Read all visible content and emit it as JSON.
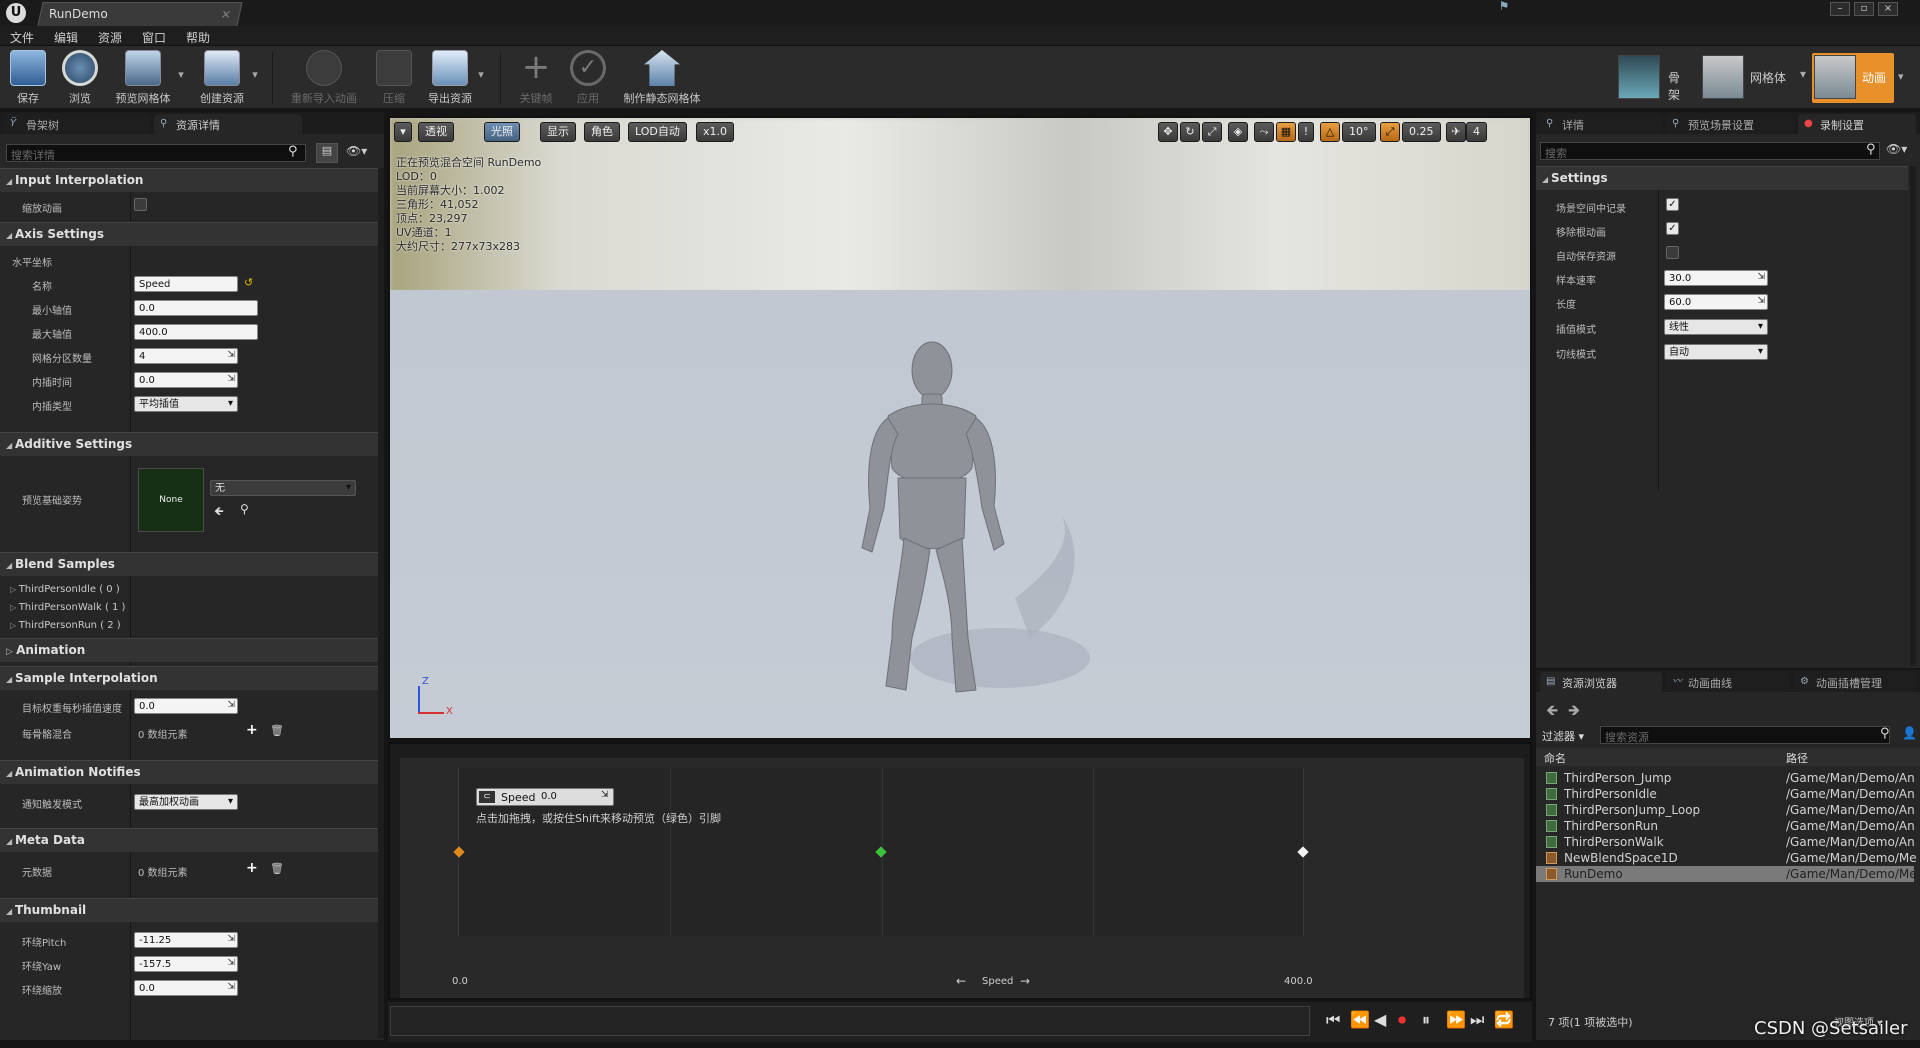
{
  "window": {
    "tab_title": "RunDemo",
    "logo": "U"
  },
  "menu": [
    "文件",
    "编辑",
    "资源",
    "窗口",
    "帮助"
  ],
  "toolbar": {
    "buttons": [
      {
        "label": "保存",
        "icon": "save-icon"
      },
      {
        "label": "浏览",
        "icon": "browse-icon"
      },
      {
        "label": "预览网格体",
        "icon": "preview-mesh-icon"
      },
      {
        "label": "创建资源",
        "icon": "create-asset-icon"
      },
      {
        "label": "重新导入动画",
        "icon": "reimport-icon"
      },
      {
        "label": "压缩",
        "icon": "compress-icon"
      },
      {
        "label": "导出资源",
        "icon": "export-icon"
      },
      {
        "label": "关键帧",
        "icon": "key-icon"
      },
      {
        "label": "应用",
        "icon": "apply-icon"
      },
      {
        "label": "制作静态网格体",
        "icon": "static-mesh-icon"
      }
    ],
    "modes": [
      "骨架",
      "网格体",
      "动画"
    ]
  },
  "left": {
    "tabs": [
      "骨架树",
      "资源详情"
    ],
    "search_placeholder": "搜索详情",
    "sections": {
      "input_interp": "Input Interpolation",
      "axis": "Axis Settings",
      "additive": "Additive Settings",
      "blend": "Blend Samples",
      "animation": "Animation",
      "sample_interp": "Sample Interpolation",
      "notifies": "Animation Notifies",
      "meta": "Meta Data",
      "thumbnail": "Thumbnail"
    },
    "scale_anim_label": "缩放动画",
    "horiz_axis_label": "水平坐标",
    "axis_rows": [
      {
        "label": "名称",
        "value": "Speed"
      },
      {
        "label": "最小轴值",
        "value": "0.0"
      },
      {
        "label": "最大轴值",
        "value": "400.0"
      },
      {
        "label": "网格分区数量",
        "value": "4"
      },
      {
        "label": "内插时间",
        "value": "0.0"
      },
      {
        "label": "内插类型",
        "value": "平均插值"
      }
    ],
    "preview_pose_label": "预览基础姿势",
    "preview_pose_thumb": "None",
    "preview_pose_combo": "无",
    "blend_samples": [
      "ThirdPersonIdle ( 0 )",
      "ThirdPersonWalk ( 1 )",
      "ThirdPersonRun ( 2 )"
    ],
    "target_weight_label": "目标权重每秒插值速度",
    "target_weight_value": "0.0",
    "per_bone_label": "每骨骼混合",
    "per_bone_value": "0 数组元素",
    "notify_mode_label": "通知触发模式",
    "notify_mode_value": "最高加权动画",
    "meta_label": "元数据",
    "meta_value": "0 数组元素",
    "thumb_rows": [
      {
        "label": "环绕Pitch",
        "value": "-11.25"
      },
      {
        "label": "环绕Yaw",
        "value": "-157.5"
      },
      {
        "label": "环绕缩放",
        "value": "0.0"
      }
    ]
  },
  "viewport": {
    "buttons": [
      "透视",
      "光照",
      "显示",
      "角色",
      "LOD自动",
      "x1.0"
    ],
    "right_values": [
      "10°",
      "0.25",
      "4"
    ],
    "stats": [
      "正在预览混合空间 RunDemo",
      "LOD：0",
      "当前屏幕大小：1.002",
      "三角形：41,052",
      "顶点：23,297",
      "UV通道：1",
      "大约尺寸：277x73x283"
    ],
    "axis_z": "Z",
    "axis_x": "X"
  },
  "blend_editor": {
    "param_label": "Speed",
    "param_value": "0.0",
    "hint": "点击加拖拽，或按住Shift来移动预览（绿色）引脚",
    "x_min": "0.0",
    "x_max": "400.0",
    "axis_label": "Speed",
    "samples": [
      {
        "speed": 0,
        "color": "#e08a1e"
      },
      {
        "speed": 200,
        "color": "#3bc13b"
      },
      {
        "speed": 400,
        "color": "#f2f2f2"
      }
    ]
  },
  "right": {
    "tabs": [
      "详情",
      "预览场景设置",
      "录制设置"
    ],
    "search_placeholder": "搜索",
    "section": "Settings",
    "rows": [
      {
        "label": "场景空间中记录",
        "type": "check",
        "checked": true
      },
      {
        "label": "移除根动画",
        "type": "check",
        "checked": true
      },
      {
        "label": "自动保存资源",
        "type": "check",
        "checked": false
      },
      {
        "label": "样本速率",
        "type": "spin",
        "value": "30.0"
      },
      {
        "label": "长度",
        "type": "spin",
        "value": "60.0"
      },
      {
        "label": "插值模式",
        "type": "combo",
        "value": "线性"
      },
      {
        "label": "切线模式",
        "type": "combo",
        "value": "自动"
      }
    ]
  },
  "assets": {
    "tabs": [
      "资源浏览器",
      "动画曲线",
      "动画插槽管理"
    ],
    "filter": "过滤器",
    "search_placeholder": "搜索资源",
    "col_name": "命名",
    "col_path": "路径",
    "rows": [
      {
        "name": "ThirdPerson_Jump",
        "path": "/Game/Man/Demo/An"
      },
      {
        "name": "ThirdPersonIdle",
        "path": "/Game/Man/Demo/An"
      },
      {
        "name": "ThirdPersonJump_Loop",
        "path": "/Game/Man/Demo/An"
      },
      {
        "name": "ThirdPersonRun",
        "path": "/Game/Man/Demo/An"
      },
      {
        "name": "ThirdPersonWalk",
        "path": "/Game/Man/Demo/An"
      },
      {
        "name": "NewBlendSpace1D",
        "path": "/Game/Man/Demo/Me"
      },
      {
        "name": "RunDemo",
        "path": "/Game/Man/Demo/Me"
      }
    ],
    "selected_index": 6,
    "status": "7 项(1 项被选中)",
    "view_options": "视图选项"
  },
  "watermark": "CSDN @Setsailer"
}
